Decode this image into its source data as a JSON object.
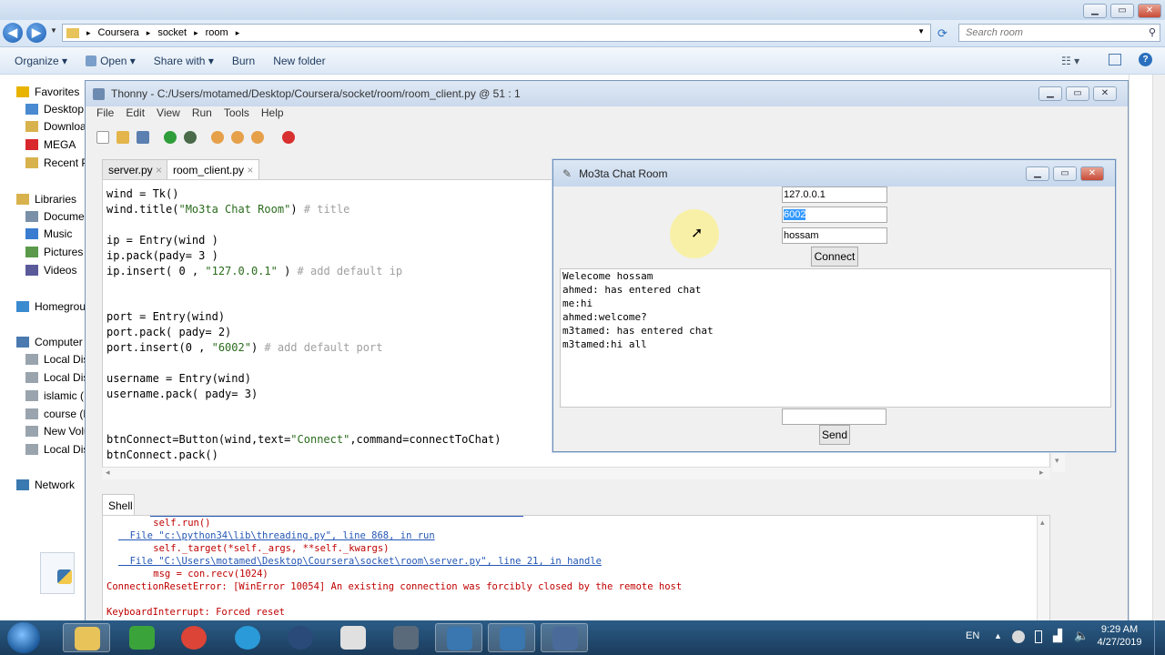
{
  "explorer": {
    "breadcrumb": [
      "Coursera",
      "socket",
      "room"
    ],
    "search_placeholder": "Search room",
    "toolbar": [
      "Organize",
      "Open",
      "Share with",
      "Burn",
      "New folder"
    ],
    "nav": [
      {
        "label": "Favorites",
        "icon": "star-icon",
        "color": "#e8b400"
      },
      {
        "label": "Desktop",
        "icon": "desktop-icon",
        "color": "#4a8ad0"
      },
      {
        "label": "Downloads",
        "icon": "downloads-icon",
        "color": "#d8b24c"
      },
      {
        "label": "MEGA",
        "icon": "mega-icon",
        "color": "#d9272e"
      },
      {
        "label": "Recent Places",
        "icon": "recent-places-icon",
        "color": "#d8b24c"
      },
      {
        "label": "Libraries",
        "icon": "libraries-icon",
        "color": "#d8b24c"
      },
      {
        "label": "Documents",
        "icon": "documents-icon",
        "color": "#7a8fa8"
      },
      {
        "label": "Music",
        "icon": "music-icon",
        "color": "#3a7dd0"
      },
      {
        "label": "Pictures",
        "icon": "pictures-icon",
        "color": "#5a9a4a"
      },
      {
        "label": "Videos",
        "icon": "videos-icon",
        "color": "#5a5a9a"
      },
      {
        "label": "Homegroup",
        "icon": "homegroup-icon",
        "color": "#3a8ad0"
      },
      {
        "label": "Computer",
        "icon": "computer-icon",
        "color": "#4a7ab0"
      },
      {
        "label": "Local Disk",
        "icon": "drive-icon",
        "color": "#9aa4ae"
      },
      {
        "label": "Local Disk",
        "icon": "drive-icon",
        "color": "#9aa4ae"
      },
      {
        "label": "islamic (E",
        "icon": "drive-icon",
        "color": "#9aa4ae"
      },
      {
        "label": "course (F",
        "icon": "drive-icon",
        "color": "#9aa4ae"
      },
      {
        "label": "New Volu",
        "icon": "drive-icon",
        "color": "#9aa4ae"
      },
      {
        "label": "Local Disk",
        "icon": "drive-icon",
        "color": "#9aa4ae"
      },
      {
        "label": "Network",
        "icon": "network-icon",
        "color": "#3a7ab0"
      }
    ]
  },
  "thonny": {
    "title": "Thonny  -  C:/Users/motamed/Desktop/Coursera/socket/room/room_client.py  @  51 : 1",
    "menu": [
      "File",
      "Edit",
      "View",
      "Run",
      "Tools",
      "Help"
    ],
    "tabs": [
      "server.py",
      "room_client.py"
    ],
    "code": [
      [
        {
          "t": "wind = Tk()",
          "c": ""
        }
      ],
      [
        {
          "t": "wind.title(",
          "c": ""
        },
        {
          "t": "\"Mo3ta Chat Room\"",
          "c": "st"
        },
        {
          "t": ") ",
          "c": ""
        },
        {
          "t": "# title",
          "c": "cm"
        }
      ],
      [],
      [
        {
          "t": "ip = Entry(wind )",
          "c": ""
        }
      ],
      [
        {
          "t": "ip.pack(pady= 3 )",
          "c": ""
        }
      ],
      [
        {
          "t": "ip.insert( 0 , ",
          "c": ""
        },
        {
          "t": "\"127.0.0.1\"",
          "c": "st"
        },
        {
          "t": " ) ",
          "c": ""
        },
        {
          "t": "# add default ip",
          "c": "cm"
        }
      ],
      [],
      [],
      [
        {
          "t": "port = Entry(wind)",
          "c": ""
        }
      ],
      [
        {
          "t": "port.pack( pady= 2)",
          "c": ""
        }
      ],
      [
        {
          "t": "port.insert(0 , ",
          "c": ""
        },
        {
          "t": "\"6002\"",
          "c": "st"
        },
        {
          "t": ") ",
          "c": ""
        },
        {
          "t": "# add default port",
          "c": "cm"
        }
      ],
      [],
      [
        {
          "t": "username = Entry(wind)",
          "c": ""
        }
      ],
      [
        {
          "t": "username.pack( pady= 3)",
          "c": ""
        }
      ],
      [],
      [],
      [
        {
          "t": "btnConnect=Button(wind,text=",
          "c": ""
        },
        {
          "t": "\"Connect\"",
          "c": "st"
        },
        {
          "t": ",command=connectToChat)",
          "c": ""
        }
      ],
      [
        {
          "t": "btnConnect.pack()",
          "c": ""
        }
      ]
    ],
    "shell_tab": "Shell",
    "shell": [
      {
        "t": "    self.run()",
        "c": "red",
        "x": 30
      },
      {
        "t": "  File \"c:\\python34\\lib\\threading.py\", line 868, in run",
        "c": "lnk",
        "x": 17
      },
      {
        "t": "    self._target(*self._args, **self._kwargs)",
        "c": "red",
        "x": 30
      },
      {
        "t": "  File \"C:\\Users\\motamed\\Desktop\\Coursera\\socket\\room\\server.py\", line 21, in handle",
        "c": "lnk",
        "x": 17
      },
      {
        "t": "    msg = con.recv(1024)",
        "c": "red",
        "x": 30
      },
      {
        "t": "ConnectionResetError: [WinError 10054] An existing connection was forcibly closed by the remote host",
        "c": "red",
        "x": 4
      },
      {
        "t": "",
        "c": "red",
        "x": 4
      },
      {
        "t": "KeyboardInterrupt: Forced reset",
        "c": "red",
        "x": 4
      }
    ]
  },
  "chat": {
    "title": "Mo3ta Chat Room",
    "ip": "127.0.0.1",
    "port": "6002",
    "username": "hossam",
    "connect": "Connect",
    "send": "Send",
    "messages": [
      "Welecome hossam",
      "ahmed: has entered chat",
      "me:hi",
      "ahmed:welcome?",
      "m3tamed: has entered chat",
      "m3tamed:hi all"
    ]
  },
  "taskbar": {
    "lang": "EN",
    "time": "9:29 AM",
    "date": "4/27/2019",
    "apps": [
      "file-explorer-icon",
      "uget-icon",
      "chrome-icon",
      "ultrasurf-icon",
      "aimp-icon",
      "snipping-tool-icon",
      "clock-app-icon",
      "python-icon",
      "python-idle-icon",
      "thonny-icon"
    ]
  }
}
